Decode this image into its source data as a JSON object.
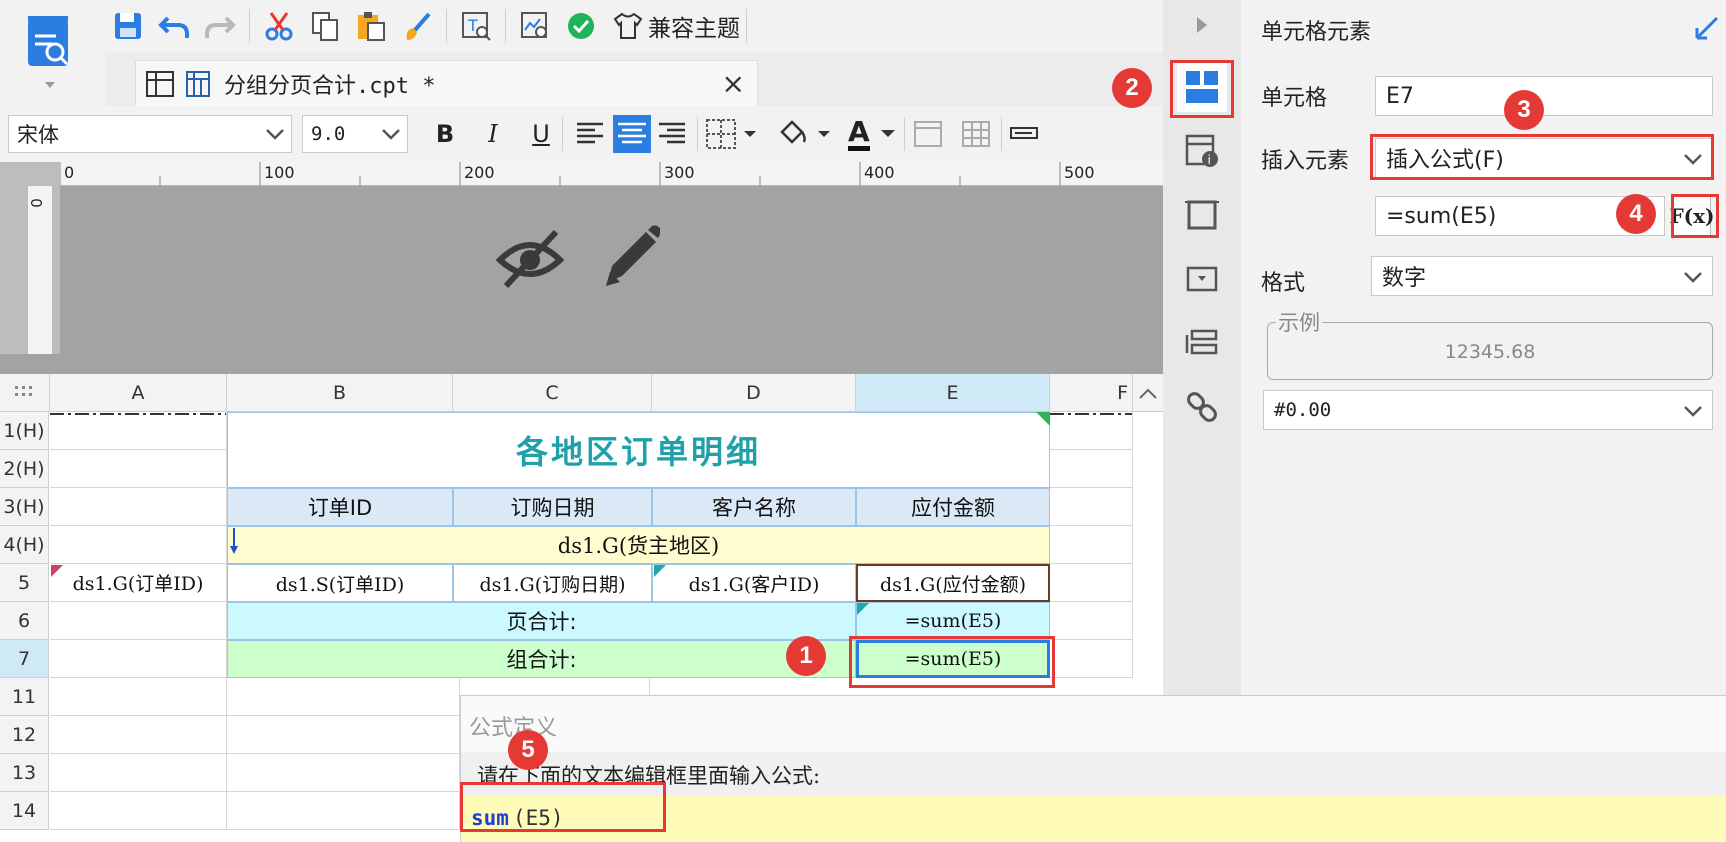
{
  "toolbar": {
    "compat_theme_label": "兼容主题"
  },
  "tab": {
    "file_name": "分组分页合计.cpt *",
    "close": "×"
  },
  "format": {
    "font_name": "宋体",
    "font_size": "9.0",
    "bold": "B",
    "italic": "I",
    "underline": "U",
    "font_color": "A"
  },
  "ruler": {
    "h_ticks": [
      "0",
      "100",
      "200",
      "300",
      "400",
      "500"
    ],
    "v_tick": "0"
  },
  "grid": {
    "columns": [
      "A",
      "B",
      "C",
      "D",
      "E",
      "F"
    ],
    "rows": [
      "1(H)",
      "2(H)",
      "3(H)",
      "4(H)",
      "5",
      "6",
      "7",
      "11",
      "12",
      "13",
      "14"
    ],
    "title": "各地区订单明细",
    "headers": [
      "订单ID",
      "订购日期",
      "客户名称",
      "应付金额"
    ],
    "group_row": "ds1.G(货主地区)",
    "row5": [
      "ds1.G(订单ID)",
      "ds1.S(订单ID)",
      "ds1.G(订购日期)",
      "ds1.G(客户ID)",
      "ds1.G(应付金额)"
    ],
    "page_total_label": "页合计:",
    "page_total_formula": "=sum(E5)",
    "group_total_label": "组合计:",
    "group_total_formula": "=sum(E5)"
  },
  "panel": {
    "title": "单元格元素",
    "cell_label": "单元格",
    "cell_value": "E7",
    "insert_label": "插入元素",
    "insert_value": "插入公式(F)",
    "formula_value": "=sum(E5)",
    "fx_label": "F(x)",
    "format_label": "格式",
    "format_value": "数字",
    "example_legend": "示例",
    "example_value": "12345.68",
    "pattern_value": "#0.00"
  },
  "dialog": {
    "title": "公式定义",
    "prompt": "请在下面的文本编辑框里面输入公式:",
    "code_fn": "sum",
    "code_arg": "(E5)"
  },
  "badges": [
    "1",
    "2",
    "3",
    "4",
    "5"
  ],
  "colors": {
    "accent_blue": "#2b7de0",
    "red": "#e53935",
    "title_teal": "#20a0a8",
    "header_blue": "#dbe9f7",
    "group_yellow": "#fffdd0",
    "page_cyan": "#ccf9ff",
    "group_green": "#ccffcc"
  }
}
